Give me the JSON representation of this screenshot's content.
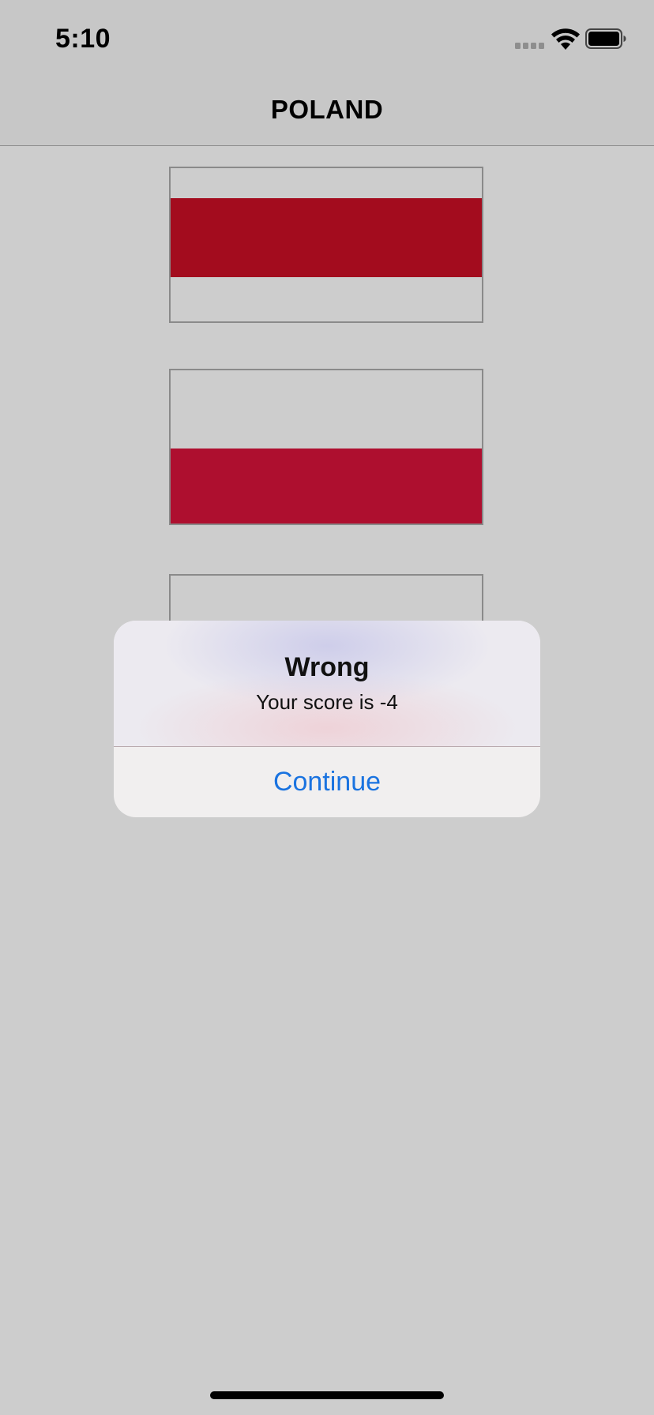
{
  "status_bar": {
    "time": "5:10",
    "signal_icon": "cellular-signal-icon",
    "wifi_icon": "wifi-icon",
    "battery_icon": "battery-icon"
  },
  "nav": {
    "title": "POLAND"
  },
  "flags": [
    {
      "name": "flag-option-1",
      "stripes": [
        "#cdcdcd",
        "#a30c1e",
        "#cdcdcd"
      ]
    },
    {
      "name": "flag-option-2",
      "stripes": [
        "#cdcdcd",
        "#ae0f2f"
      ]
    },
    {
      "name": "flag-option-3",
      "stripes": [
        "#cdcdcd"
      ]
    }
  ],
  "alert": {
    "title": "Wrong",
    "message": "Your score is -4",
    "button_label": "Continue"
  },
  "colors": {
    "background": "#cdcdcd",
    "accent_blue": "#1a73e0",
    "flag_red_1": "#a30c1e",
    "flag_red_2": "#ae0f2f"
  }
}
